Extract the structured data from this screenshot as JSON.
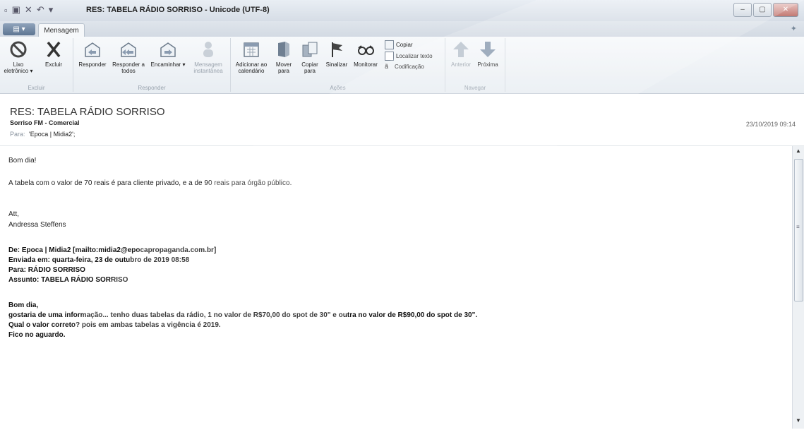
{
  "window": {
    "title": "RES: TABELA RÁDIO SORRISO - Unicode (UTF-8)",
    "min_glyph": "–",
    "max_glyph": "▢",
    "close_glyph": "✕"
  },
  "tabs": {
    "message": "Mensagem"
  },
  "ribbon": {
    "excluir": {
      "label": "Excluir",
      "junk": "Lixo eletrônico ▾",
      "delete": "Excluir"
    },
    "responder": {
      "label": "Responder",
      "reply": "Responder",
      "reply_all": "Responder a todos",
      "forward": "Encaminhar ▾",
      "im": "Mensagem instantânea"
    },
    "acoes": {
      "label": "Ações",
      "calendar": "Adicionar ao calendário",
      "move": "Mover para",
      "copy_to": "Copiar para",
      "flag": "Sinalizar",
      "monitor": "Monitorar",
      "copy": "Copiar",
      "find": "Localizar texto",
      "encoding": "Codificação"
    },
    "navegar": {
      "label": "Navegar",
      "prev": "Anterior",
      "next": "Próxima"
    }
  },
  "header": {
    "subject": "RES: TABELA RÁDIO SORRISO",
    "sender": "Sorriso FM - Comercial",
    "to_label": "Para:",
    "to_value": "'Epoca | Midia2';",
    "date": "23/10/2019 09:14"
  },
  "body": {
    "greeting": "Bom dia!",
    "line1": "A tabela com o valor de 70 reais é para cliente privado, e a de 90 reais para órgão público.",
    "signoff": "Att,",
    "signature": "Andressa Steffens",
    "q_from": "De: Epoca | Midia2 [mailto:midia2@epocapropaganda.com.br]",
    "q_sent": "Enviada em: quarta-feira, 23 de outubro de 2019 08:58",
    "q_to": "Para: RÁDIO SORRISO",
    "q_subject": "Assunto: TABELA RÁDIO SORRISO",
    "q_greeting": "Bom dia,",
    "q_line1": "gostaria de uma informação... tenho duas tabelas da rádio, 1 no valor de R$70,00 do spot de 30\" e outra no valor de R$90,00 do spot de 30\".",
    "q_line2": "Qual o valor correto? pois em ambas tabelas a vigência é 2019.",
    "q_line3": "Fico no aguardo."
  },
  "icons": [
    "save-icon",
    "undo-icon",
    "junk-icon",
    "delete-icon",
    "reply-icon",
    "reply-all-icon",
    "forward-icon",
    "im-icon",
    "calendar-icon",
    "move-icon",
    "copy-to-icon",
    "flag-icon",
    "monitor-icon",
    "copy-icon",
    "find-icon",
    "encoding-icon",
    "up-arrow-icon",
    "down-arrow-icon"
  ],
  "colors": {
    "accent": "#5d7592",
    "close": "#c27a74",
    "arrow_disabled": "#b9c3cd",
    "arrow_enabled": "#8a9bb0"
  }
}
